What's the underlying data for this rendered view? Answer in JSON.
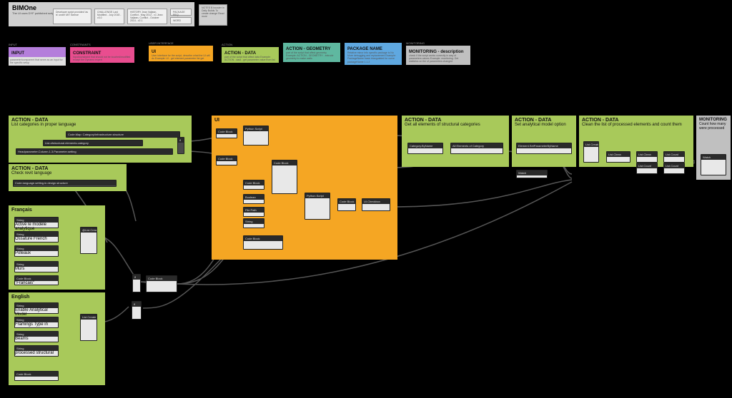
{
  "header": {
    "title": "BIMOne",
    "subtitle": "The UI uses DYF published script",
    "box1": "Developer\nscript provided 'as is' under MIT license",
    "box2": "CHALLENGE\nLast Modified - July 2018 - v3.0",
    "box3": "HISTORY\nJean Valjean, Conflict - May 2012 - v1\nJean Valjean, Conflict - October 2014 - v2.1",
    "box4": "PACKAGE REQ",
    "box5": "NOTES\nB booster in Daily Builds\nTo create change\nRead more",
    "word": "WORD"
  },
  "legend": {
    "input": {
      "label": "INPUT",
      "title": "INPUT",
      "desc": "parameter/component that serve as an input for the specific setup"
    },
    "constraint": {
      "label": "CONSTRAINTS",
      "title": "CONSTRAINT",
      "desc": "Input/constraint that should not be touched/modified except the Dynamo expert"
    },
    "ui": {
      "label": "USER INTERFACE",
      "title": "UI",
      "desc": "User interface for the script, describe what the UI will do\n\nExample:\nUI - get element parameter list get"
    },
    "actiondata": {
      "label": "ACTION",
      "title": "ACTION - DATA",
      "desc": "part of the script that affect data\n\nExample:\nACTION - data - get parameter value from list"
    },
    "actiongeom": {
      "label": "",
      "title": "ACTION - GEOMETRY",
      "desc": "part of the script that affect geometry\n\nExample:\nACTION - GEOMETRY - extrude geometry to make walls"
    },
    "package": {
      "label": "",
      "title": "PACKAGE NAME",
      "desc": "Relative minor info specific package is No More debugging and replacement\n\nExample:\nPackageName basic triangulated for curve\npackageName 1.1.2"
    },
    "monitoring": {
      "label": "MONITORING",
      "title": "MONITORING - description",
      "desc": "check if the script works correctly in way of parameters values\n\nExample:\nmonitoring. Get statistics on the of parameters changed"
    }
  },
  "groups": {
    "g1": {
      "t": "ACTION - DATA",
      "s": "List categories in proper language"
    },
    "g2": {
      "t": "ACTION - DATA",
      "s": "Check revit language"
    },
    "g3": {
      "t": "Français",
      "s": ""
    },
    "g4": {
      "t": "English",
      "s": ""
    },
    "g5": {
      "t": "UI",
      "s": ""
    },
    "g6": {
      "t": "ACTION - DATA",
      "s": "Get all elements of structural categories"
    },
    "g7": {
      "t": "ACTION - DATA",
      "s": "Set analytical model option"
    },
    "g8": {
      "t": "ACTION - DATA",
      "s": "Clean the list of processed elements and count them"
    },
    "g9": {
      "t": "MONITORING",
      "s": "Count how many were processed"
    }
  },
  "nodes": {
    "n1": "Code.Map: Category/infrastructure.structure",
    "n2": "List.ofstructural.elements.category",
    "n3": "Headparameter.Column.1.3.Parameter.setting",
    "n4": "if",
    "n5": "Code.language.setting.in.design.structure",
    "n6": "String",
    "n7": "Activé le modèle analytique",
    "n8": "String",
    "n9": "Ossature French",
    "n10": "String",
    "n11": "Poteaux",
    "n12": "String",
    "n13": "Murs",
    "n14": "Code Block",
    "n15": "\"Francais\"",
    "n16": "@List.Create",
    "n17": "String",
    "n18": "Enable Analytical Model",
    "n19": "String",
    "n20": "Framings Type in",
    "n21": "String",
    "n22": "Beams",
    "n23": "String",
    "n24": "processed structural",
    "n25": "Code Block",
    "n26": "List.Create",
    "cn1": "if",
    "cn2": "Code Block",
    "cn3": "if",
    "u1": "Code Block",
    "u2": "Python Script",
    "u3": "Code Block",
    "u4": "Code Block",
    "u5": "Code Block",
    "u6": "Boolean",
    "u7": "File Path",
    "u8": "String",
    "u9": "Code Block",
    "u10": "Python.Script",
    "u11": "Code Block",
    "u12": "UI.Checkbox",
    "a1": "Category.ByName",
    "a2": "All Elements of Category",
    "b1": "Element.SetParameterByName",
    "c1": "List.Create",
    "c2": "List.Clean",
    "c3": "List.Count",
    "m1": "Watch",
    "m2": "Watch"
  }
}
